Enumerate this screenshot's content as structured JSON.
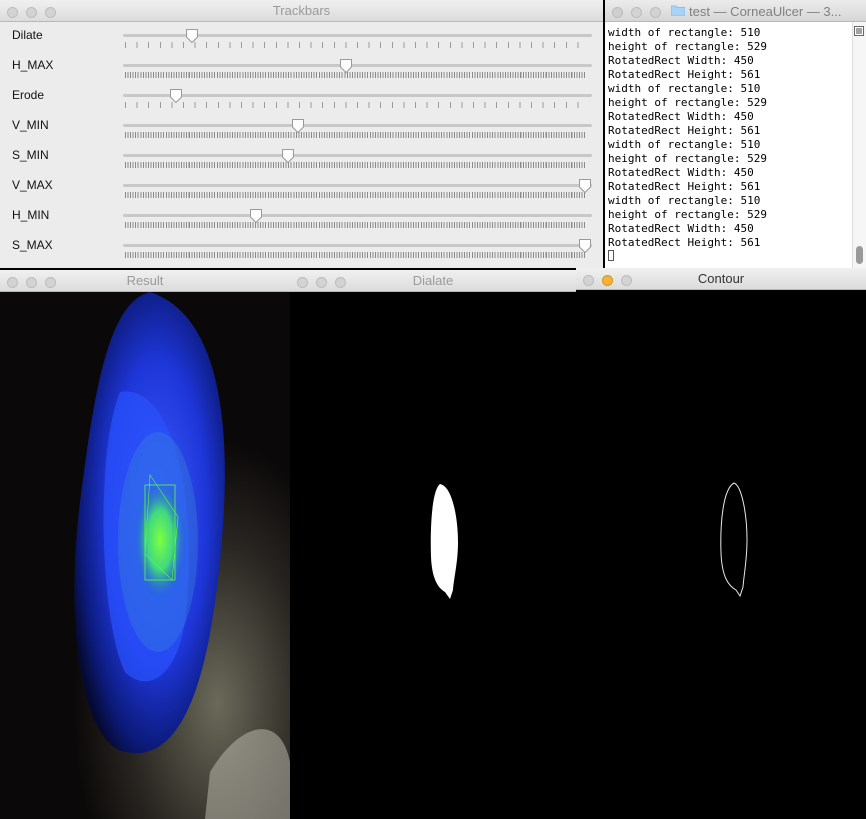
{
  "trackbars": {
    "title": "Trackbars",
    "sliders": [
      {
        "label": "Dilate",
        "fraction": 0.145,
        "ticks": "sparse"
      },
      {
        "label": "H_MAX",
        "fraction": 0.48,
        "ticks": "dense"
      },
      {
        "label": "Erode",
        "fraction": 0.11,
        "ticks": "sparse"
      },
      {
        "label": "V_MIN",
        "fraction": 0.375,
        "ticks": "dense"
      },
      {
        "label": "S_MIN",
        "fraction": 0.355,
        "ticks": "dense"
      },
      {
        "label": "V_MAX",
        "fraction": 1.0,
        "ticks": "dense"
      },
      {
        "label": "H_MIN",
        "fraction": 0.285,
        "ticks": "dense"
      },
      {
        "label": "S_MAX",
        "fraction": 1.0,
        "ticks": "dense"
      }
    ]
  },
  "terminal": {
    "title": "test — CorneaUlcer — 3...",
    "lines": [
      "width of rectangle: 510",
      "height of rectangle: 529",
      "RotatedRect Width: 450",
      "RotatedRect Height: 561",
      "width of rectangle: 510",
      "height of rectangle: 529",
      "RotatedRect Width: 450",
      "RotatedRect Height: 561",
      "width of rectangle: 510",
      "height of rectangle: 529",
      "RotatedRect Width: 450",
      "RotatedRect Height: 561",
      "width of rectangle: 510",
      "height of rectangle: 529",
      "RotatedRect Width: 450",
      "RotatedRect Height: 561"
    ]
  },
  "result": {
    "title": "Result"
  },
  "dialate": {
    "title": "Dialate"
  },
  "contour": {
    "title": "Contour"
  },
  "colors": {
    "cornea_blue": "#2a4cff",
    "ulcer_green": "#5cff3a",
    "window_bg": "#ececec"
  }
}
